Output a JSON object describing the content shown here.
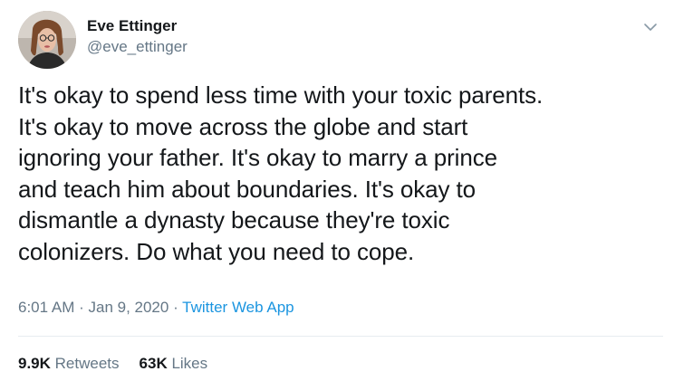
{
  "author": {
    "display_name": "Eve Ettinger",
    "handle": "@eve_ettinger"
  },
  "tweet": {
    "lines": [
      "It's okay to spend less time with your toxic parents.",
      "It's okay to move across the globe and start",
      "ignoring your father. It's okay to marry a prince",
      "and teach him about boundaries. It's okay to",
      "dismantle a dynasty because they're toxic",
      "colonizers. Do what you need to cope."
    ],
    "time": "6:01 AM",
    "separator": " · ",
    "date": "Jan 9, 2020",
    "source": "Twitter Web App"
  },
  "stats": {
    "retweets_count": "9.9K",
    "retweets_label": "Retweets",
    "likes_count": "63K",
    "likes_label": "Likes"
  },
  "icons": {
    "caret": "chevron-down-icon",
    "avatar": "avatar"
  },
  "colors": {
    "text": "#14171a",
    "secondary": "#657786",
    "link": "#1b95e0",
    "divider": "#e6ecf0"
  }
}
